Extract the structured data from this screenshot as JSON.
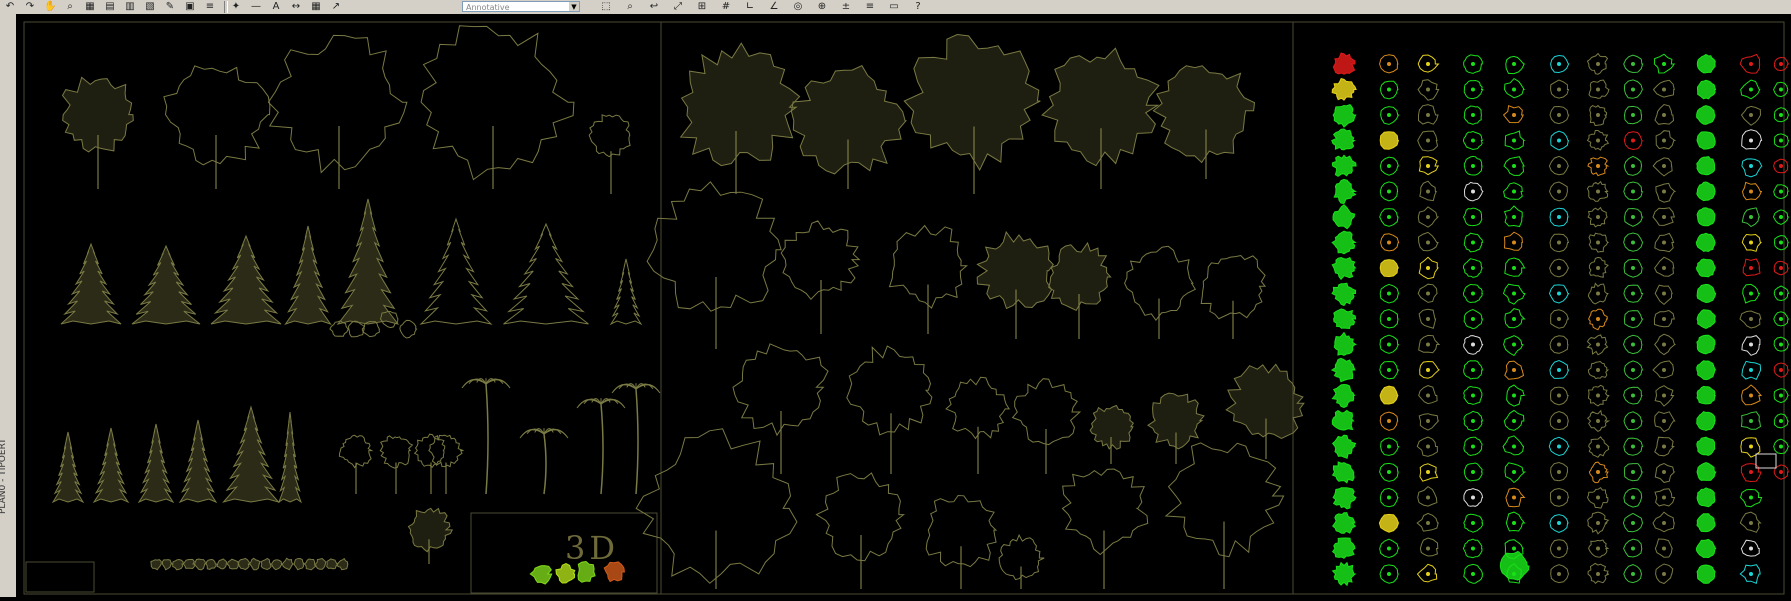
{
  "toolbar": {
    "annotation_scale": "Annotative",
    "icons": [
      "undo-icon",
      "redo-icon",
      "pan-icon",
      "zoom-icon",
      "properties-icon",
      "design-center-icon",
      "tool-palettes-icon",
      "sheet-set-icon",
      "markup-icon",
      "calculator-icon",
      "layer-icon",
      "match-properties-icon",
      "linetype-icon",
      "text-style-icon",
      "dim-style-icon",
      "table-style-icon",
      "multileader-icon",
      "select-icon",
      "zoom-window-icon",
      "zoom-previous-icon",
      "zoom-extents-icon",
      "snap-icon",
      "grid-icon",
      "ortho-icon",
      "polar-icon",
      "osnap-icon",
      "otrack-icon",
      "dyn-icon",
      "lwt-icon",
      "model-icon",
      "help-icon"
    ]
  },
  "sidebar": {
    "label": "PLAN0 - TIPOERT"
  },
  "drawing": {
    "label_3d": "3D",
    "colors": {
      "olive": "#7a7a44",
      "olive_dark": "#5d5d34",
      "green": "#3bbf3b",
      "bright_green": "#19e019",
      "yellow": "#e6d21a",
      "red": "#e11a1a",
      "cyan": "#1ad5d5",
      "orange": "#d88a1a",
      "white": "#dcdcdc",
      "border": "#4a4a33"
    }
  }
}
